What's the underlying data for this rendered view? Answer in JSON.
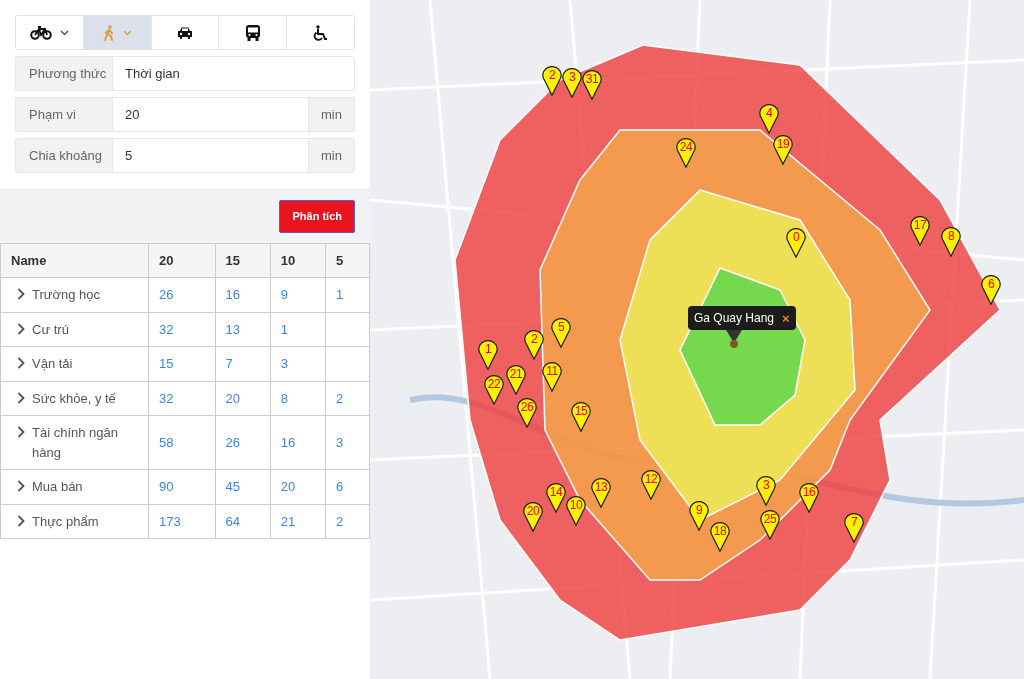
{
  "travel_modes": [
    {
      "kind": "bicycle",
      "dropdown": true,
      "selected": false
    },
    {
      "kind": "walk",
      "dropdown": true,
      "selected": true
    },
    {
      "kind": "car",
      "dropdown": false,
      "selected": false
    },
    {
      "kind": "bus",
      "dropdown": false,
      "selected": false
    },
    {
      "kind": "wheelchair",
      "dropdown": false,
      "selected": false
    }
  ],
  "form": {
    "method": {
      "label": "Phương thức",
      "value": "Thời gian"
    },
    "range": {
      "label": "Phạm vi",
      "value": "20",
      "unit": "min"
    },
    "step": {
      "label": "Chia khoảng",
      "value": "5",
      "unit": "min"
    }
  },
  "analyze_button": "Phân tích",
  "table": {
    "columns": [
      "Name",
      "20",
      "15",
      "10",
      "5"
    ],
    "rows": [
      {
        "name": "Trường học",
        "values": [
          "26",
          "16",
          "9",
          "1"
        ]
      },
      {
        "name": "Cư trú",
        "values": [
          "32",
          "13",
          "1"
        ]
      },
      {
        "name": "Vận tải",
        "values": [
          "15",
          "7",
          "3"
        ]
      },
      {
        "name": "Sức khỏe, y tế",
        "values": [
          "32",
          "20",
          "8",
          "2"
        ]
      },
      {
        "name": "Tài chính ngân hàng",
        "values": [
          "58",
          "26",
          "16",
          "3"
        ]
      },
      {
        "name": "Mua bán",
        "values": [
          "90",
          "45",
          "20",
          "6"
        ]
      },
      {
        "name": "Thực phẩm",
        "values": [
          "173",
          "64",
          "21",
          "2"
        ]
      }
    ]
  },
  "map": {
    "popup": {
      "title": "Ga Quay Hang",
      "close": "×"
    },
    "markers": [
      "0",
      "1",
      "2",
      "3",
      "4",
      "5",
      "6",
      "7",
      "8",
      "9",
      "10",
      "11",
      "12",
      "13",
      "14",
      "15",
      "16",
      "17",
      "18",
      "19",
      "20",
      "21",
      "22",
      "24",
      "25",
      "26",
      "2",
      "3",
      "31"
    ]
  }
}
